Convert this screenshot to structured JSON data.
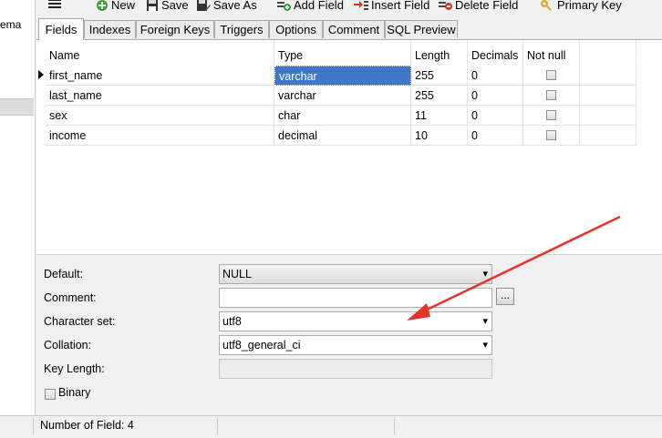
{
  "sidebar": {
    "fragment": "ema"
  },
  "toolbar": {
    "new": "New",
    "save": "Save",
    "save_as": "Save As",
    "add_field": "Add Field",
    "insert_field": "Insert Field",
    "delete_field": "Delete Field",
    "primary_key": "Primary Key"
  },
  "tabs": [
    "Fields",
    "Indexes",
    "Foreign Keys",
    "Triggers",
    "Options",
    "Comment",
    "SQL Preview"
  ],
  "grid": {
    "headers": [
      "Name",
      "Type",
      "Length",
      "Decimals",
      "Not null"
    ],
    "rows": [
      {
        "name": "first_name",
        "type": "varchar",
        "length": "255",
        "decimals": "0"
      },
      {
        "name": "last_name",
        "type": "varchar",
        "length": "255",
        "decimals": "0"
      },
      {
        "name": "sex",
        "type": "char",
        "length": "11",
        "decimals": "0"
      },
      {
        "name": "income",
        "type": "decimal",
        "length": "10",
        "decimals": "0"
      }
    ]
  },
  "props": {
    "default_label": "Default:",
    "default_value": "NULL",
    "comment_label": "Comment:",
    "comment_value": "",
    "charset_label": "Character set:",
    "charset_value": "utf8",
    "collation_label": "Collation:",
    "collation_value": "utf8_general_ci",
    "keylength_label": "Key Length:",
    "keylength_value": "",
    "binary_label": "Binary",
    "ellipsis": "..."
  },
  "status": {
    "field_count": "Number of Field: 4"
  },
  "colors": {
    "selection": "#3e78c9",
    "annotation_arrow": "#e8332a"
  }
}
